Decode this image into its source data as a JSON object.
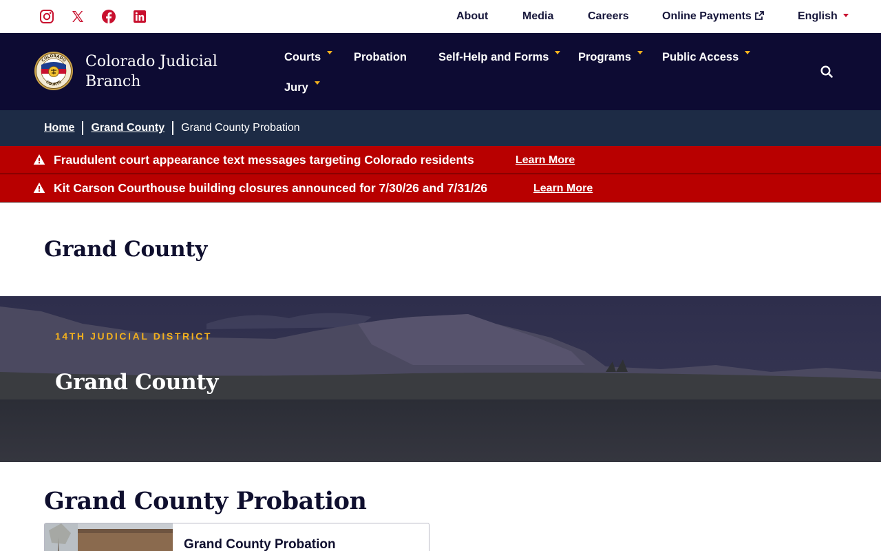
{
  "social": {
    "items": [
      {
        "name": "instagram-icon"
      },
      {
        "name": "x-twitter-icon"
      },
      {
        "name": "facebook-icon"
      },
      {
        "name": "linkedin-icon"
      }
    ],
    "color": "#c8102e"
  },
  "utility_nav": {
    "about": "About",
    "media": "Media",
    "careers": "Careers",
    "online_payments": "Online Payments",
    "language": "English"
  },
  "header": {
    "brand_line1": "Colorado Judicial",
    "brand_line2": "Branch",
    "seal_text_top": "COLORADO",
    "seal_text_bottom": "COURTS",
    "nav": {
      "courts": "Courts",
      "probation": "Probation",
      "self_help": "Self-Help and Forms",
      "programs": "Programs",
      "public_access": "Public Access",
      "jury": "Jury"
    },
    "background": "#0d0b33",
    "accent": "#f2b01e"
  },
  "breadcrumb": {
    "home": "Home",
    "county": "Grand County",
    "current": "Grand County Probation"
  },
  "alerts": [
    {
      "message": "Fraudulent court appearance text messages targeting Colorado residents",
      "link": "Learn More"
    },
    {
      "message": "Kit Carson Courthouse building closures announced for 7/30/26 and 7/31/26",
      "link": "Learn More"
    }
  ],
  "alert_color": "#b80000",
  "page": {
    "title": "Grand County"
  },
  "hero": {
    "eyebrow": "14TH JUDICIAL DISTRICT",
    "title": "Grand County"
  },
  "section": {
    "title": "Grand County Probation",
    "card_title": "Grand County Probation"
  }
}
